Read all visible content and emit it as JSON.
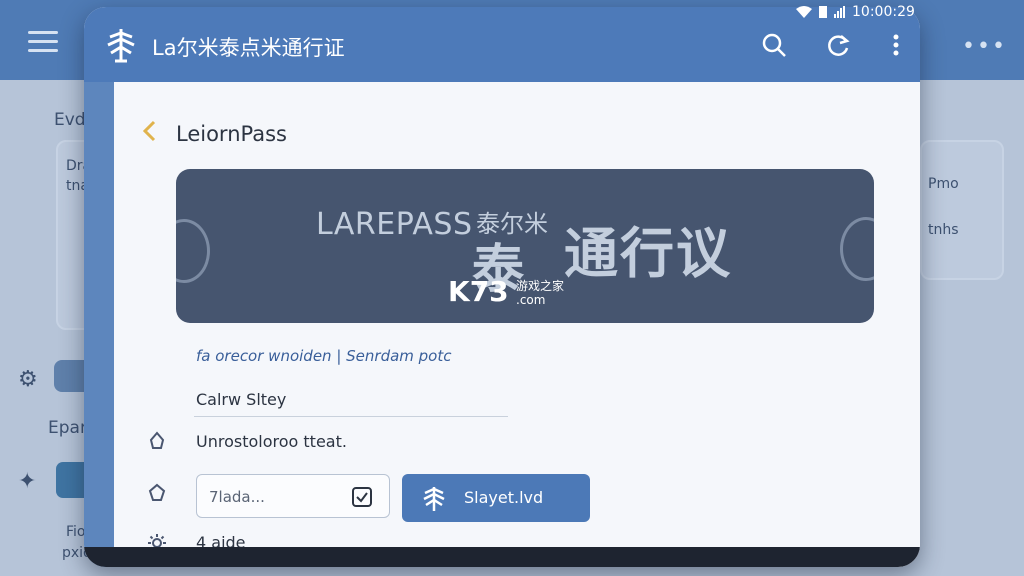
{
  "status_bar": {
    "time": "10:00:29"
  },
  "background": {
    "heading1": "Evdnc",
    "card_line1": "Drai",
    "card_line2": "tnas",
    "heading2": "Eparric",
    "side_text1": "Pmo",
    "side_text2": "tnhs",
    "footer1": "Fioss",
    "footer2": "pxioss"
  },
  "window": {
    "title": "La尔米泰点米通行证",
    "logo_icon": "tree-logo-icon",
    "actions": [
      "search-icon",
      "refresh-icon",
      "more-vertical-icon"
    ]
  },
  "page": {
    "back_icon": "chevron-left-icon",
    "title": "LeiornPass"
  },
  "banner": {
    "brand": "LAREPASS",
    "cn_small": "泰尔米",
    "cn_big": "泰",
    "cn_big2": "通行议",
    "watermark": "K73",
    "watermark_small1": "游戏之家",
    "watermark_small2": ".com"
  },
  "subtitle_link": "fa orecor wnoiden | Senrdam potc",
  "name_label": "Calrw Sltey",
  "rows": [
    {
      "icon": "star-icon",
      "text": "Unrostoloroo tteat."
    },
    {
      "icon": "star-outline-icon",
      "text": ""
    },
    {
      "icon": "settings-icon",
      "text": "4 aide"
    }
  ],
  "input": {
    "value": "7lada..."
  },
  "primary_button": {
    "label": "Slayet.lvd"
  },
  "colors": {
    "accent": "#4c79b7",
    "bar": "#4d7ab9",
    "banner": "#46556f"
  }
}
